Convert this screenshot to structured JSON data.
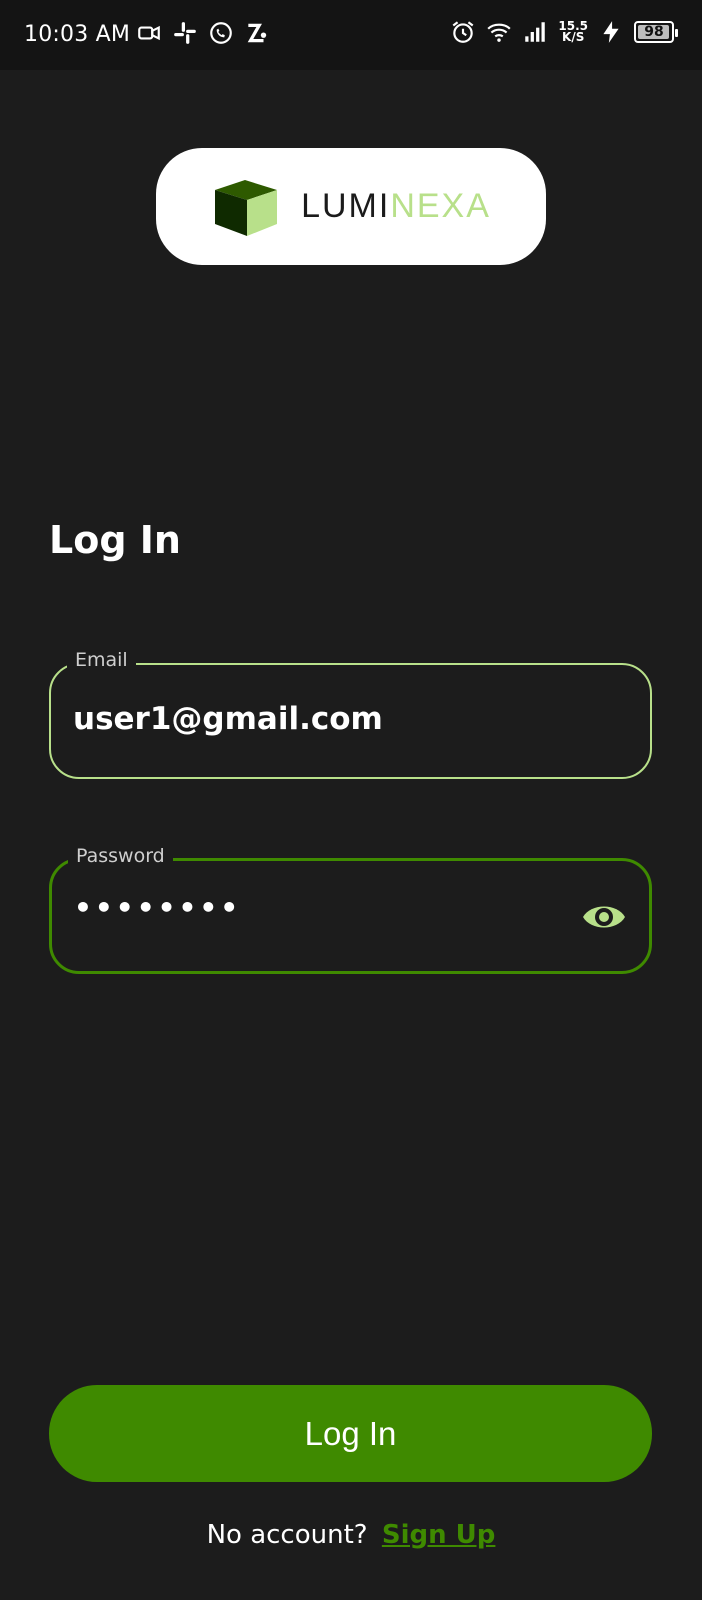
{
  "status_bar": {
    "time": "10:03 AM",
    "left_icons": [
      "video-icon",
      "slack-icon",
      "whatsapp-icon",
      "app-icon"
    ],
    "right_icons": [
      "alarm-icon",
      "wifi-icon",
      "signal-icon",
      "charging-icon"
    ],
    "net_speed_value": "15.5",
    "net_speed_unit": "K/S",
    "battery": "98",
    "battery_level": 0.98
  },
  "logo": {
    "dark_part": "LUMI",
    "light_part": "NEXA",
    "icon": "cube-icon",
    "colors": {
      "dark": "#1b1b1b",
      "light": "#b8e08a",
      "cube_dark": "#2e5a00",
      "cube_light": "#b8e08a"
    }
  },
  "page": {
    "title": "Log In"
  },
  "form": {
    "email": {
      "label": "Email",
      "value": "user1@gmail.com"
    },
    "password": {
      "label": "Password",
      "value": "••••••••",
      "toggle_icon": "eye-icon"
    }
  },
  "actions": {
    "login_label": "Log In",
    "no_account_text": "No account?",
    "signup_label": "Sign Up"
  },
  "colors": {
    "background": "#1c1c1c",
    "accent": "#3f8a00",
    "accent_light": "#b8e08a"
  }
}
